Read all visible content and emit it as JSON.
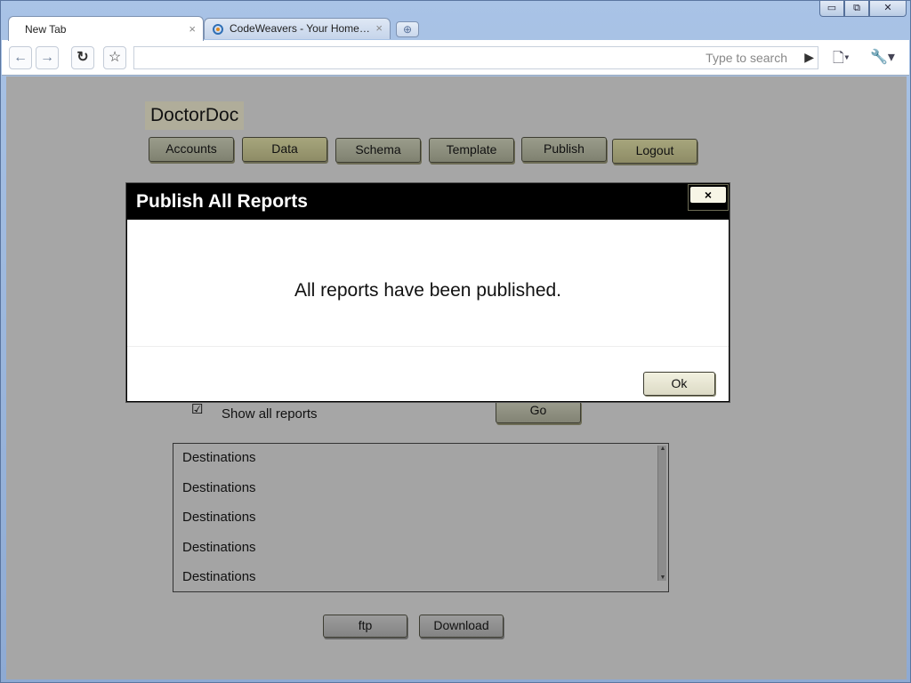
{
  "browser": {
    "tabs": [
      {
        "label": "New Tab"
      },
      {
        "label": "CodeWeavers - Your Home…"
      }
    ],
    "new_tab_glyph": "⊕",
    "window_controls": {
      "minimize": "▭",
      "restore": "⧉",
      "close": "✕"
    },
    "omnibox_placeholder": "Type to search",
    "icons": {
      "back": "back-arrow-icon",
      "forward": "forward-arrow-icon",
      "reload": "reload-icon",
      "star": "star-icon",
      "page_menu": "page-menu-icon",
      "wrench": "wrench-icon"
    }
  },
  "app": {
    "title": "DoctorDoc",
    "nav": [
      "Accounts",
      "Data",
      "Schema",
      "Template",
      "Publish",
      "Logout"
    ],
    "show_all_reports": {
      "label": "Show all reports",
      "checked": true
    },
    "go_label": "Go",
    "destinations": [
      "Destinations",
      "Destinations",
      "Destinations",
      "Destinations",
      "Destinations"
    ],
    "ftp_label": "ftp",
    "download_label": "Download"
  },
  "modal": {
    "title": "Publish All Reports",
    "close_glyph": "×",
    "message": "All reports have been published.",
    "ok_label": "Ok"
  },
  "colors": {
    "page_overlay": "#a6a6a6",
    "modal_header": "#000000",
    "accent_button": "#8e8c66"
  }
}
